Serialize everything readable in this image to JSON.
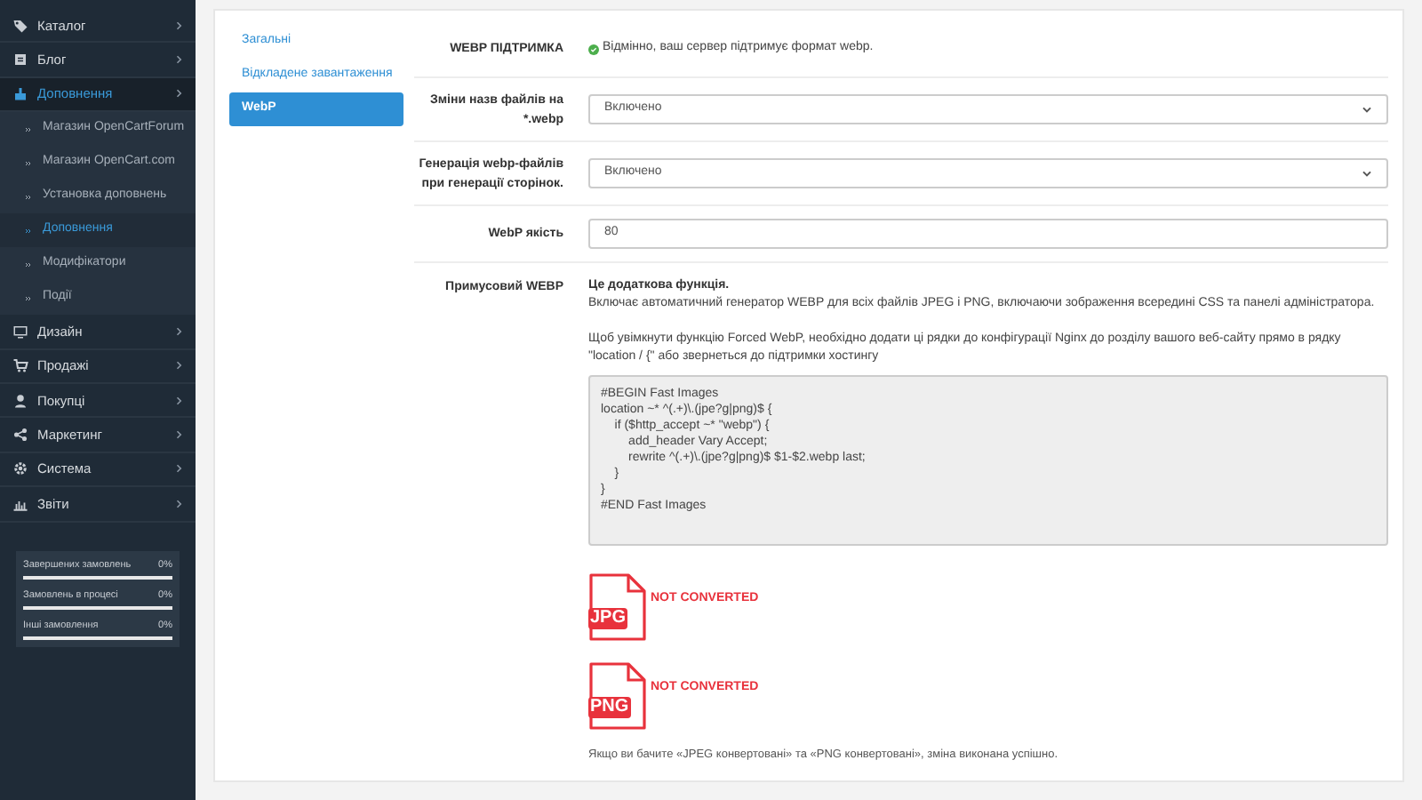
{
  "sidebar": {
    "items": [
      {
        "label": "Каталог",
        "selected": false
      },
      {
        "label": "Блог",
        "selected": false
      },
      {
        "label": "Доповнення",
        "selected": true,
        "expanded": true,
        "children": [
          {
            "label": "Магазин OpenCartForum",
            "selected": false
          },
          {
            "label": "Магазин OpenCart.com",
            "selected": false
          },
          {
            "label": "Установка доповнень",
            "selected": false
          },
          {
            "label": "Доповнення",
            "selected": true
          },
          {
            "label": "Модифікатори",
            "selected": false
          },
          {
            "label": "Події",
            "selected": false
          }
        ]
      },
      {
        "label": "Дизайн",
        "selected": false
      },
      {
        "label": "Продажі",
        "selected": false
      },
      {
        "label": "Покупці",
        "selected": false
      },
      {
        "label": "Маркетинг",
        "selected": false
      },
      {
        "label": "Система",
        "selected": false
      },
      {
        "label": "Звіти",
        "selected": false
      }
    ],
    "stats": [
      {
        "label": "Завершених замовлень",
        "value": "0%",
        "level": 0
      },
      {
        "label": "Замовлень в процесі",
        "value": "0%",
        "level": 0
      },
      {
        "label": "Інші замовлення",
        "value": "0%",
        "level": 0
      }
    ]
  },
  "tabs": [
    {
      "label": "Загальні",
      "selected": false
    },
    {
      "label": "Відкладене завантаження",
      "selected": false
    },
    {
      "label": "WebP",
      "selected": true
    }
  ],
  "form": [
    {
      "kind": "status",
      "label": "WEBP ПІДТРИМКА",
      "text": "Відмінно, ваш сервер підтримує формат webp."
    },
    {
      "kind": "select",
      "label": "Зміни назв файлів на *.webp",
      "value": "Включено"
    },
    {
      "kind": "select",
      "label": "Генерація webp-файлів при генерації сторінок.",
      "value": "Включено"
    },
    {
      "kind": "input",
      "label": "WebP якість",
      "value": "80"
    },
    {
      "kind": "info",
      "label": "Примусовий WEBP",
      "heading": "Це додаткова функція.",
      "description": "Включає автоматичний генератор WEBP для всіх файлів JPEG і PNG, включаючи зображення всередині CSS та панелі адміністратора.",
      "instructions": "Щоб увімкнути функцію Forced WebP, необхідно додати ці рядки до конфігурації Nginx до розділу вашого веб-сайту прямо в рядку \"location / {\" або звернеться до підтримки хостингу",
      "code": "#BEGIN Fast Images\nlocation ~* ^(.+)\\.(jpe?g|png)$ {\n    if ($http_accept ~* \"webp\") {\n        add_header Vary Accept;\n        rewrite ^(.+)\\.(jpe?g|png)$ $1-$2.webp last;\n    }\n}\n#END Fast Images",
      "checks": [
        {
          "type": "JPG",
          "status": "NOT CONVERTED"
        },
        {
          "type": "PNG",
          "status": "NOT CONVERTED"
        }
      ],
      "footer": "Якщо ви бачите «JPEG конвертовані» та «PNG конвертовані», зміна виконана успішно."
    }
  ]
}
